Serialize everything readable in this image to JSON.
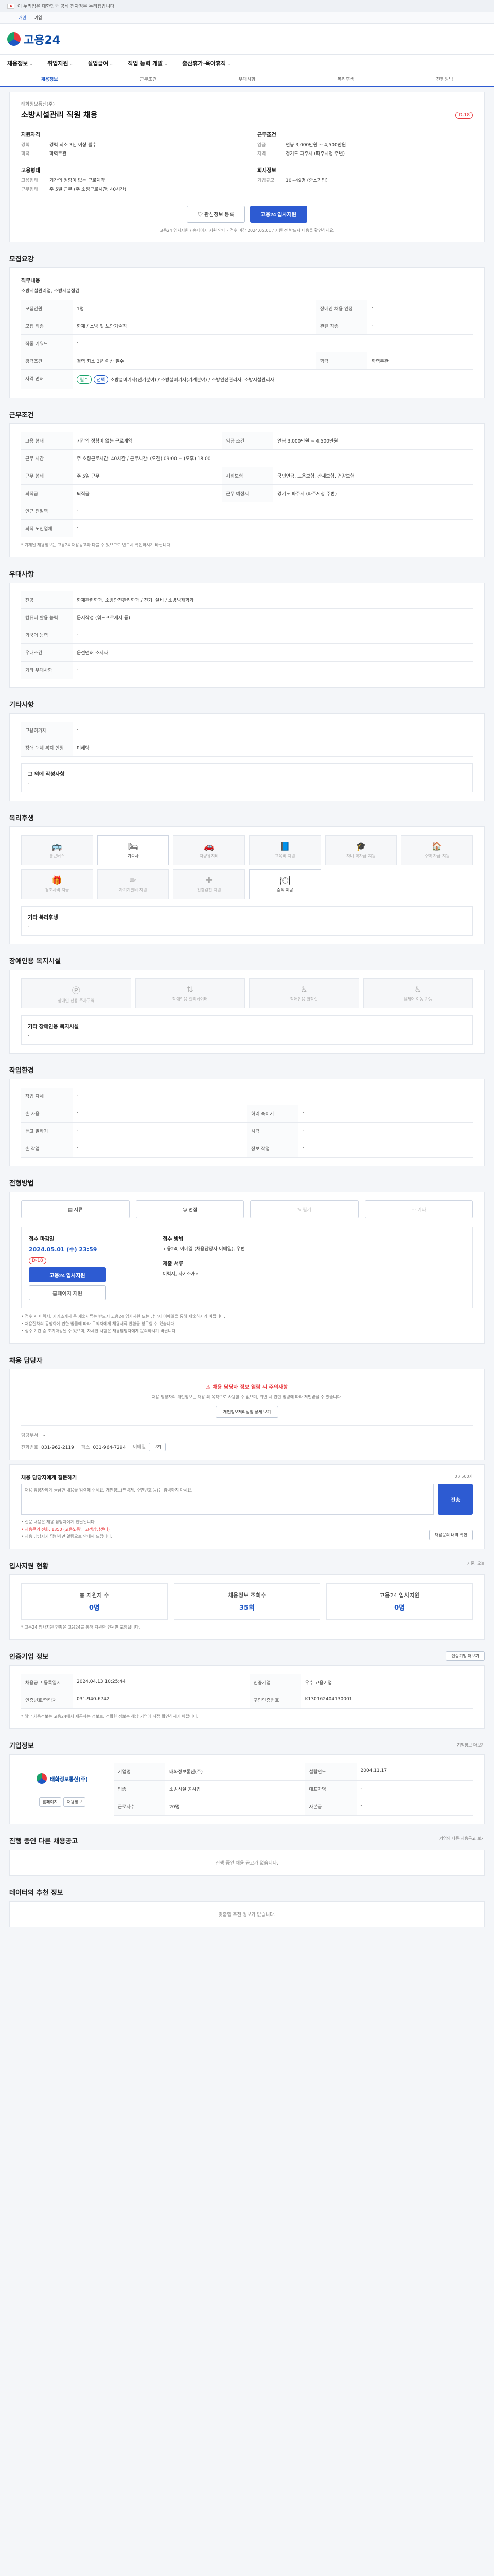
{
  "gov_banner": "이 누리집은 대한민국 공식 전자정부 누리집입니다.",
  "subbar": [
    "개인",
    "기업"
  ],
  "logo": "고용24",
  "gnb": [
    "채용정보",
    "취업지원",
    "실업급여",
    "직업 능력 개발",
    "출산휴가·육아휴직"
  ],
  "lnb": [
    "채용정보",
    "근무조건",
    "우대사항",
    "복리후생",
    "전형방법"
  ],
  "job": {
    "company_label": "태화정보통신(주)",
    "title": "소방시설관리 직원 채용",
    "dday": "D-18",
    "left_head": "지원자격",
    "left_rows": [
      {
        "k": "경력",
        "v": "경력 최소 3년 이상 필수"
      },
      {
        "k": "학력",
        "v": "학력무관"
      }
    ],
    "right_head": "근무조건",
    "right_rows": [
      {
        "k": "임금",
        "v": "연봉 3,000만원 ~ 4,500만원"
      },
      {
        "k": "지역",
        "v": "경기도 파주시 (파주시청 주변)"
      }
    ],
    "left2_head": "고용형태",
    "left2_rows": [
      {
        "k": "고용형태",
        "v": "기간의 정함이 없는 근로계약"
      },
      {
        "k": "근무형태",
        "v": "주 5일 근무 (주 소정근로시간: 40시간)"
      }
    ],
    "right2_head": "회사정보",
    "right2_rows": [
      {
        "k": "기업규모",
        "v": "10~49명 (중소기업)"
      }
    ],
    "btn_save": "관심정보 등록",
    "btn_apply": "고용24 입사지원",
    "note": "고용24 입사지원 / 홈페이지 지원 안내 - 접수 마감 2024.05.01 / 지원 전 반드시 내용을 확인하세요."
  },
  "recruit": {
    "title": "모집요강",
    "duty_label": "직무내용",
    "duty": "소방시설관리업, 소방시설점검",
    "rows": [
      {
        "k": "모집인원",
        "v": "1명",
        "k2": "장애인 채용 인정",
        "v2": "-"
      },
      {
        "k": "모집 직종",
        "v": "화재 / 소방 및 보안기술직",
        "k2": "관련 직종",
        "v2": "-"
      },
      {
        "k": "직종 키워드",
        "v": "-",
        "k2": "",
        "v2": ""
      },
      {
        "k": "경력조건",
        "v": "경력 최소 3년 이상 필수",
        "k2": "학력",
        "v2": "학력무관"
      },
      {
        "k": "자격 면허",
        "v": "소방설비기사(전기분야) / 소방설비기사(기계분야) / 소방안전관리자, 소방시설관리사",
        "k2": "",
        "v2": ""
      }
    ],
    "extra": [
      "선택",
      "필수"
    ]
  },
  "work": {
    "title": "근무조건",
    "rows": [
      {
        "k": "고용 형태",
        "v": "기간의 정함이 없는 근로계약",
        "k2": "임금 조건",
        "v2": "연봉 3,000만원 ~ 4,500만원"
      },
      {
        "k": "근무 시간",
        "v": "주 소정근로시간: 40시간 / 근무시간: (오전) 09:00 ~ (오후) 18:00",
        "k2": "",
        "v2": ""
      },
      {
        "k": "근무 형태",
        "v": "주 5일 근무",
        "k2": "사회보험",
        "v2": "국민연금, 고용보험, 산재보험, 건강보험"
      },
      {
        "k": "퇴직금",
        "v": "퇴직금",
        "k2": "근무 예정지",
        "v2": "경기도 파주시 (파주시청 주변)"
      },
      {
        "k": "인근 전철역",
        "v": "-",
        "k2": "",
        "v2": ""
      },
      {
        "k": "퇴직 노인업체",
        "v": "-",
        "k2": "",
        "v2": ""
      }
    ],
    "note": "* 기재된 채용정보는 고용24 채용공고와 다를 수 있으므로 반드시 확인하시기 바랍니다."
  },
  "prefer": {
    "title": "우대사항",
    "rows": [
      {
        "k": "전공",
        "v": "화재관련학과, 소방안전관리학과 / 전기, 설비 / 소방방재학과"
      },
      {
        "k": "컴퓨터 활용 능력",
        "v": "문서작성 (워드프로세서 등)"
      },
      {
        "k": "외국어 능력",
        "v": "-"
      },
      {
        "k": "우대조건",
        "v": "운전면허 소지자"
      },
      {
        "k": "기타 우대사항",
        "v": "-"
      }
    ]
  },
  "other": {
    "title": "기타사항",
    "rows": [
      {
        "k": "고용허가제",
        "v": "-"
      },
      {
        "k": "장애 대체 복지 인정",
        "v": "미해당"
      }
    ],
    "comment_title": "그 외에 작성사항",
    "comment": "-"
  },
  "welfare": {
    "title": "복리후생",
    "items": [
      "통근버스",
      "기숙사",
      "차량유지비",
      "교육비 지원",
      "자녀 학자금 지원",
      "주택 자금 지원",
      "경조사비 지급",
      "자기계발비 지원",
      "건강검진 지원",
      "중식 제공"
    ],
    "active": [
      1,
      9
    ],
    "other_label": "기타 복리후생",
    "other_value": "-"
  },
  "disability": {
    "title": "장애인용 복지시설",
    "items": [
      "장애인 전용 주차구역",
      "장애인용 엘리베이터",
      "장애인용 화장실",
      "휠체어 이동 가능"
    ],
    "other_label": "기타 장애인용 복지시설",
    "other_value": "-"
  },
  "place": {
    "title": "작업환경",
    "rows": [
      {
        "k": "작업 자세",
        "v": "-",
        "k2": "",
        "v2": ""
      },
      {
        "k": "손 사용",
        "v": "-",
        "k2": "허리 숙이기",
        "v2": "-"
      },
      {
        "k": "듣고 말하기",
        "v": "-",
        "k2": "시력",
        "v2": "-"
      },
      {
        "k": "손 작업",
        "v": "-",
        "k2": "장보 작업",
        "v2": "-"
      }
    ]
  },
  "process": {
    "title": "전형방법",
    "steps": [
      "서류",
      "면접",
      "필기",
      "기타"
    ],
    "active": [
      0,
      1
    ],
    "period_label": "접수 마감일",
    "period_value": "2024.05.01 (수) 23:59",
    "dday": "D-18",
    "btn_apply": "고용24 입사지원",
    "btn_home": "홈페이지 지원",
    "method_label": "접수 방법",
    "methods": "고용24, 이메일 (채용담당자 이메일), 우편",
    "docs_label": "제출 서류",
    "docs": "이력서, 자기소개서",
    "notices": [
      "• 접수 시 이력서, 자기소개서 등 제출서류는 반드시 고용24 입사지원 또는 담당자 이메일을 통해 제출하시기 바랍니다.",
      "• 채용절차의 공정화에 관한 법률에 따라 구직자에게 채용서류 반환을 청구할 수 있습니다.",
      "• 접수 기간 중 조기마감될 수 있으며, 자세한 사항은 채용담당자에게 문의하시기 바랍니다."
    ]
  },
  "contact": {
    "title": "채용 담당자",
    "alert_head": "채용 담당자 정보 열람 시 주의사항",
    "alert_body": "채용 담당자의 개인정보는 채용 외 목적으로 사용할 수 없으며, 위반 시 관련 법령에 따라 처벌받을 수 있습니다.",
    "alert_btn": "개인정보처리방침 상세 보기",
    "dept_label": "담당부서",
    "dept": "-",
    "tel_label": "전화번호",
    "tel": "031-962-2119",
    "fax_label": "팩스",
    "fax": "031-964-7294",
    "email_label": "이메일",
    "email_btn": "보기"
  },
  "inquiry": {
    "title": "채용 담당자에게 질문하기",
    "count": "0 / 500자",
    "placeholder": "채용 담당자에게 궁금한 내용을 입력해 주세요. 개인정보(연락처, 주민번호 등)는 입력하지 마세요.",
    "btn": "전송",
    "notes": [
      "• 질문 내용은 채용 담당자에게 전달됩니다.",
      "• 채용문의 전화: 1350 (고용노동부 고객상담센터)",
      "• 채용 담당자가 답변하면 알림으로 안내해 드립니다."
    ],
    "sub_btn": "채용문의 내역 확인"
  },
  "stats": {
    "title": "입사지원 현황",
    "unit": "기준: 오늘",
    "items": [
      {
        "label": "총 지원자 수",
        "value": "0명"
      },
      {
        "label": "채용정보 조회수",
        "value": "35회"
      },
      {
        "label": "고용24 입사지원",
        "value": "0명"
      }
    ],
    "note": "* 고용24 입사지원 현황은 고용24를 통해 지원한 인원만 포함됩니다."
  },
  "cert": {
    "title": "인증기업 정보",
    "btn": "인증기업 더보기",
    "rows": [
      {
        "k": "채용공고 등록일시",
        "v": "2024.04.13 10:25:44",
        "k2": "인증기업",
        "v2": "우수 고용기업"
      },
      {
        "k": "인증번호/연락처",
        "v": "031-940-6742",
        "k2": "구인인증번호",
        "v2": "K130162404130001"
      }
    ],
    "note": "* 해당 채용정보는 고용24에서 제공하는 정보로, 정확한 정보는 해당 기업에 직접 확인하시기 바랍니다."
  },
  "company": {
    "title": "기업정보",
    "more": "기업정보 더보기",
    "name": "태화정보통신(주)",
    "rows": [
      {
        "k": "기업명",
        "v": "태화정보통신(주)",
        "k2": "설립연도",
        "v2": "2004.11.17"
      },
      {
        "k": "업종",
        "v": "소방시설 공사업",
        "k2": "대표자명",
        "v2": "-"
      },
      {
        "k": "근로자수",
        "v": "20명",
        "k2": "자본금",
        "v2": "-"
      }
    ],
    "btn1": "홈페이지",
    "btn2": "채용정보"
  },
  "recent": {
    "title": "진행 중인 다른 채용공고",
    "more": "기업의 다른 채용공고 보기",
    "empty": "진행 중인 채용 공고가 없습니다."
  },
  "recommend": {
    "title": "데이터의 추천 정보",
    "empty": "맞춤형 추천 정보가 없습니다."
  }
}
